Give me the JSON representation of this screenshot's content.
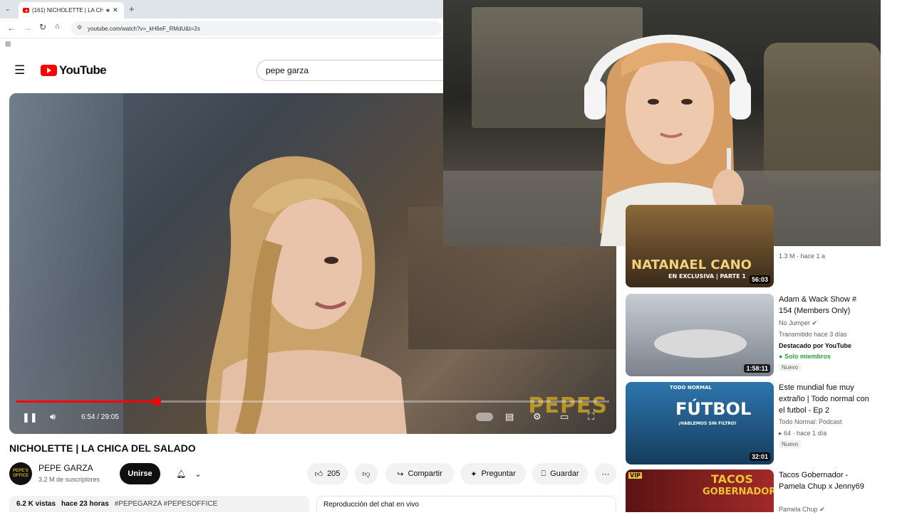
{
  "browser": {
    "tab_title": "(161) NICHOLETTE | LA CHI",
    "new_tab": "+",
    "url": "youtube.com/watch?v=_kH6eF_RMdU&t=2s"
  },
  "youtube": {
    "logo_text": "YouTube",
    "search_value": "pepe garza"
  },
  "player": {
    "time": "6:54 / 29:05",
    "progress_percent": 23.7,
    "watermark": "PEPES"
  },
  "video": {
    "title": "NICHOLETTE | LA CHICA DEL SALADO",
    "channel": {
      "name": "PEPE GARZA",
      "subscribers": "3.2 M de suscriptores",
      "avatar_text": "PEPE'S OFFICE"
    },
    "join_label": "Unirse",
    "likes": "205",
    "share_label": "Compartir",
    "ask_label": "Preguntar",
    "save_label": "Guardar",
    "views": "6.2 K vistas",
    "age": "hace 23 horas",
    "tags": "#PEPEGARZA #PEPESOFFICE",
    "chat_replay": "Reproducción del chat en vivo"
  },
  "recommendations": [
    {
      "title": "",
      "meta1": "1.3 M · hace 1 a",
      "duration": "56:03",
      "thumb_line1": "NATANAEL CANO",
      "thumb_line2": "EN EXCLUSIVA | PARTE 1",
      "thumb_color": "#6b4e2a"
    },
    {
      "title": "Adam & Wack Show  # 154 (Members Only)",
      "channel": "No Jumper",
      "meta1": "Transmitido hace 3 días",
      "featured": "Destacado por YouTube",
      "members": "Solo miembros",
      "badge": "Nuevo",
      "duration": "1:58:11",
      "thumb_color": "#9aa2ab"
    },
    {
      "title": "Este mundial fue muy extraño | Todo normal con el futbol - Ep 2",
      "channel": "Todo Normal: Podcast",
      "meta1": "64 · hace 1 día",
      "badge": "Nuevo",
      "duration": "32:01",
      "thumb_line1": "FÚTBOL",
      "thumb_line2": "¡HABLEMOS SIN FILTRO!",
      "thumb_top": "TODO NORMAL",
      "thumb_color": "#1f5a86"
    },
    {
      "title": "Tacos Gobernador - Pamela Chup x Jenny69",
      "channel": "Pamela Chup",
      "thumb_line1": "TACOS",
      "thumb_line2": "GOBERNADOR",
      "thumb_vip": "VIP",
      "thumb_color": "#7e1b1b"
    }
  ],
  "colors": {
    "youtube_red": "#ff0000",
    "progress_red": "#ff0000",
    "members_green": "#2ba640"
  }
}
